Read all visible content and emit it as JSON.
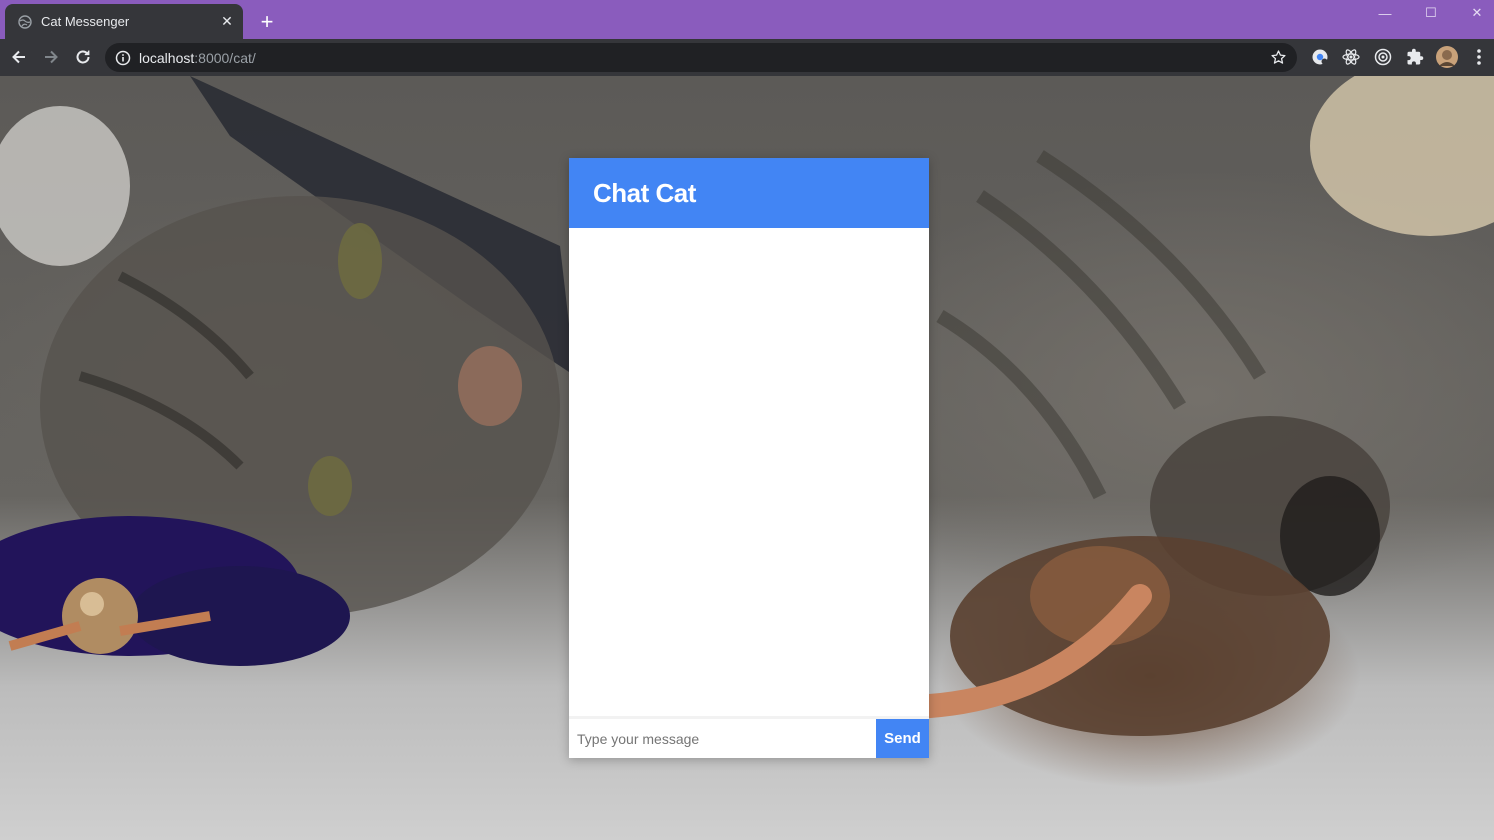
{
  "browser": {
    "tab_title": "Cat Messenger",
    "tab_close": "✕",
    "new_tab": "+",
    "url_host": "localhost",
    "url_rest": ":8000/cat/",
    "window_controls": {
      "minimize": "—",
      "maximize": "☐",
      "close": "✕"
    }
  },
  "chat": {
    "title": "Chat Cat",
    "input_placeholder": "Type your message",
    "send_label": "Send"
  },
  "colors": {
    "titlebar": "#8a5cbd",
    "toolbar": "#35363a",
    "accent": "#4285f4"
  }
}
